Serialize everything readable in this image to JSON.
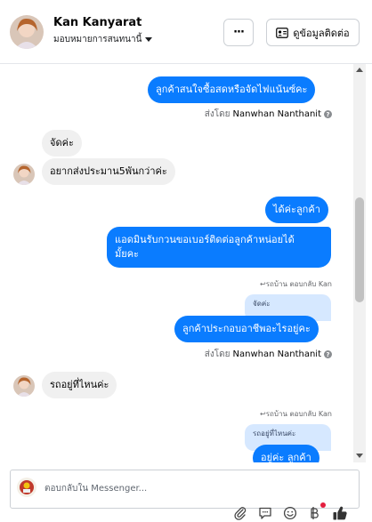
{
  "header": {
    "name": "Kan Kanyarat",
    "assign_label": "มอบหมายการสนทนานี้",
    "more_label": "···",
    "info_label": "ดูข้อมูลติดต่อ"
  },
  "messages": [
    {
      "kind": "out",
      "text": "ลูกค้าสนใจซื้อสดหรือจัดไฟแน้นซ์คะ"
    },
    {
      "kind": "meta",
      "prefix": "ส่งโดย",
      "sender": "Nanwhan Nanthanit"
    },
    {
      "kind": "in",
      "text": "จัดค่ะ"
    },
    {
      "kind": "in",
      "text": "อยากส่งประมาน5พันกว่าค่ะ"
    },
    {
      "kind": "out",
      "text": "ได้ค่ะลูกค้า"
    },
    {
      "kind": "out",
      "text_line1": "แอดมินรับกวนขอเบอร์ติดต่อลูกค้าหน่อยได้",
      "text_line2": "มั้ยคะ"
    },
    {
      "kind": "reply_meta",
      "text": "↩รถบ้าน ตอบกลับ Kan"
    },
    {
      "kind": "quote",
      "text": "จัดค่ะ"
    },
    {
      "kind": "out",
      "text": "ลูกค้าประกอบอาชีพอะไรอยู่คะ"
    },
    {
      "kind": "meta",
      "prefix": "ส่งโดย",
      "sender": "Nanwhan Nanthanit"
    },
    {
      "kind": "in",
      "text": "รถอยู่ที่ไหนค่ะ"
    },
    {
      "kind": "reply_meta",
      "text": "↩รถบ้าน ตอบกลับ Kan"
    },
    {
      "kind": "quote",
      "text": "รถอยู่ที่ไหนค่ะ"
    },
    {
      "kind": "out",
      "text": "อยู่ค่ะ ลูกค้า"
    }
  ],
  "composer": {
    "placeholder": "ตอบกลับใน Messenger..."
  },
  "icons": [
    "more-icon",
    "contact-card-icon",
    "caret-down-icon",
    "info-icon",
    "attach-icon",
    "saved-reply-icon",
    "emoji-icon",
    "currency-icon",
    "like-icon"
  ],
  "colors": {
    "outgoing": "#0a7cff",
    "incoming": "#f0f0f0",
    "quote": "#d6e8ff",
    "notification": "#e41e3f"
  }
}
